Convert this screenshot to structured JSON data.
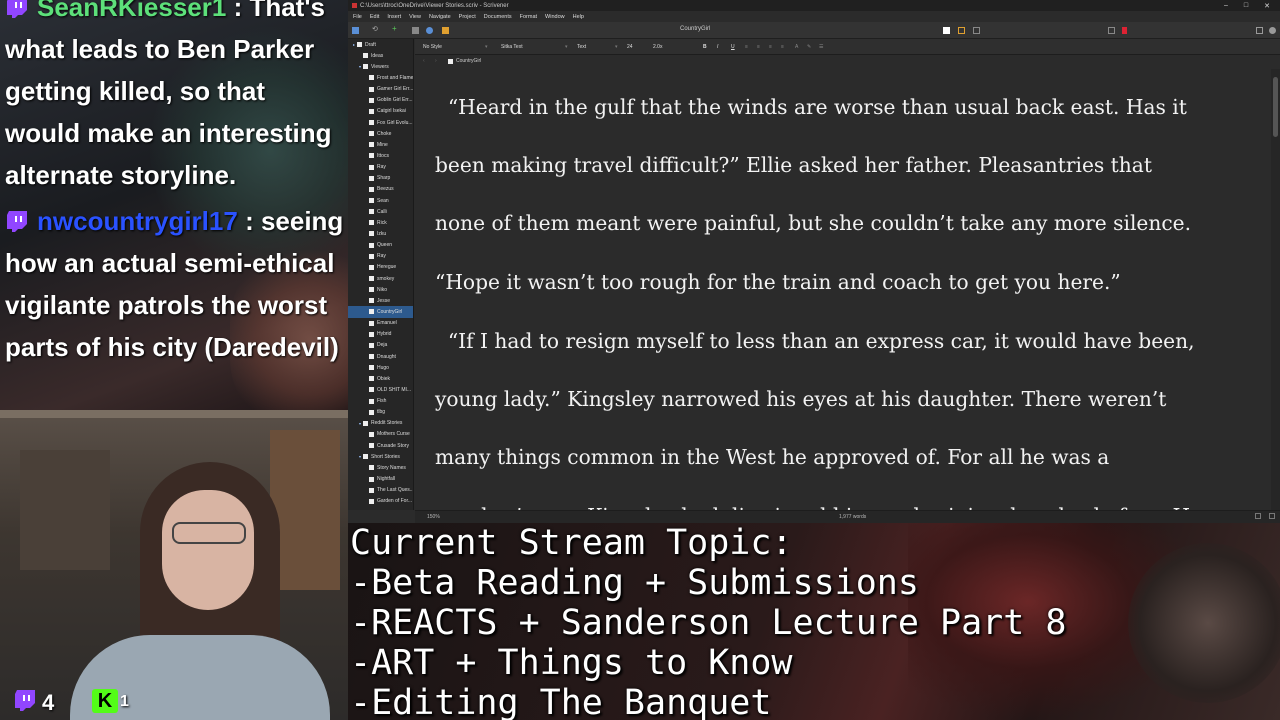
{
  "chat": {
    "messages": [
      {
        "user": "SeanRKiesser1",
        "user_color": "#5de07a",
        "text": ": That's what leads to Ben Parker getting killed, so that would make an interesting alternate storyline."
      },
      {
        "user": "nwcountrygirl17",
        "user_color": "#2a52ff",
        "text": ": seeing how an actual semi-ethical vigilante patrols the worst parts of his city (Daredevil)"
      }
    ],
    "badge_icon": "twitch-icon"
  },
  "webcam": {
    "viewer_count": "4",
    "k_badge_label": "K",
    "k_badge_count": "1"
  },
  "app": {
    "window_title": "C:\\Users\\ttroc\\OneDrive\\Viewer Stories.scriv - Scrivener",
    "window_controls": [
      "–",
      "□",
      "✕"
    ],
    "menu": [
      "File",
      "Edit",
      "Insert",
      "View",
      "Navigate",
      "Project",
      "Documents",
      "Format",
      "Window",
      "Help"
    ],
    "document_title": "CountryGirl",
    "format_bar": {
      "style": "No Style",
      "font": "Sitka Text",
      "face": "Text",
      "size": "24",
      "spacing": "2.0x",
      "buttons": [
        "B",
        "I",
        "U"
      ]
    },
    "path": "CountryGirl",
    "binder": [
      {
        "label": "Draft",
        "indent": 0,
        "arrow": "▸"
      },
      {
        "label": "Ideas",
        "indent": 1
      },
      {
        "label": "Viewers",
        "indent": 1,
        "arrow": "▾"
      },
      {
        "label": "Frost and Flame",
        "indent": 2
      },
      {
        "label": "Gamer Girl Err...",
        "indent": 2
      },
      {
        "label": "Goblin Girl Err...",
        "indent": 2
      },
      {
        "label": "Catgirl Isekai",
        "indent": 2
      },
      {
        "label": "Fox Girl Evolu...",
        "indent": 2
      },
      {
        "label": "Choke",
        "indent": 2
      },
      {
        "label": "Mine",
        "indent": 2
      },
      {
        "label": "Ittocs",
        "indent": 2
      },
      {
        "label": "Ray",
        "indent": 2
      },
      {
        "label": "Sharp",
        "indent": 2
      },
      {
        "label": "Beezus",
        "indent": 2
      },
      {
        "label": "Sean",
        "indent": 2
      },
      {
        "label": "Calli",
        "indent": 2
      },
      {
        "label": "Rick",
        "indent": 2
      },
      {
        "label": "Izku",
        "indent": 2
      },
      {
        "label": "Queen",
        "indent": 2
      },
      {
        "label": "Ray",
        "indent": 2
      },
      {
        "label": "Heregue",
        "indent": 2
      },
      {
        "label": "smokey",
        "indent": 2
      },
      {
        "label": "Niko",
        "indent": 2
      },
      {
        "label": "Jesse",
        "indent": 2
      },
      {
        "label": "CountryGirl",
        "indent": 2,
        "selected": true
      },
      {
        "label": "Emanuel",
        "indent": 2
      },
      {
        "label": "Hybrid",
        "indent": 2
      },
      {
        "label": "Deja",
        "indent": 2
      },
      {
        "label": "Dnaught",
        "indent": 2
      },
      {
        "label": "Hugo",
        "indent": 2
      },
      {
        "label": "Obiek",
        "indent": 2
      },
      {
        "label": "OLD SHIT MI...",
        "indent": 2
      },
      {
        "label": "Fish",
        "indent": 2
      },
      {
        "label": "tlbg",
        "indent": 2
      },
      {
        "label": "Reddit Stories",
        "indent": 1,
        "arrow": "▾"
      },
      {
        "label": "Mothers Curse",
        "indent": 2
      },
      {
        "label": "Crusade Story",
        "indent": 2
      },
      {
        "label": "Short Stories",
        "indent": 1,
        "arrow": "▾"
      },
      {
        "label": "Story Names",
        "indent": 2
      },
      {
        "label": "Nightfall",
        "indent": 2
      },
      {
        "label": "The Last Ques...",
        "indent": 2
      },
      {
        "label": "Garden of For...",
        "indent": 2
      }
    ],
    "editor_lines": [
      "  “Heard in the gulf that the winds are worse than usual back east. Has it",
      "been making travel difficult?” Ellie asked her father. Pleasantries that",
      "none of them meant were painful, but she couldn’t take any more silence.",
      "“Hope it wasn’t too rough for the train and coach to get you here.”",
      "  “If I had to resign myself to less than an express car, it would have been,",
      "young lady.” Kingsley narrowed his eyes at his daughter. There weren’t",
      "many things common in the West he approved of. For all he was a",
      "rancher’s son, Kingsley had dismissed his rural origins decades before. He"
    ],
    "status": {
      "zoom": "150%",
      "word_count": "1,977 words"
    }
  },
  "topic": {
    "lines": [
      "Current Stream Topic:",
      "-Beta Reading + Submissions",
      "-REACTS + Sanderson Lecture Part 8",
      "-ART + Things to Know",
      "-Editing The Banquet"
    ]
  },
  "colors": {
    "accent_select": "#2d5a8e",
    "twitch_purple": "#9146ff",
    "k_badge_green": "#53fc18"
  }
}
